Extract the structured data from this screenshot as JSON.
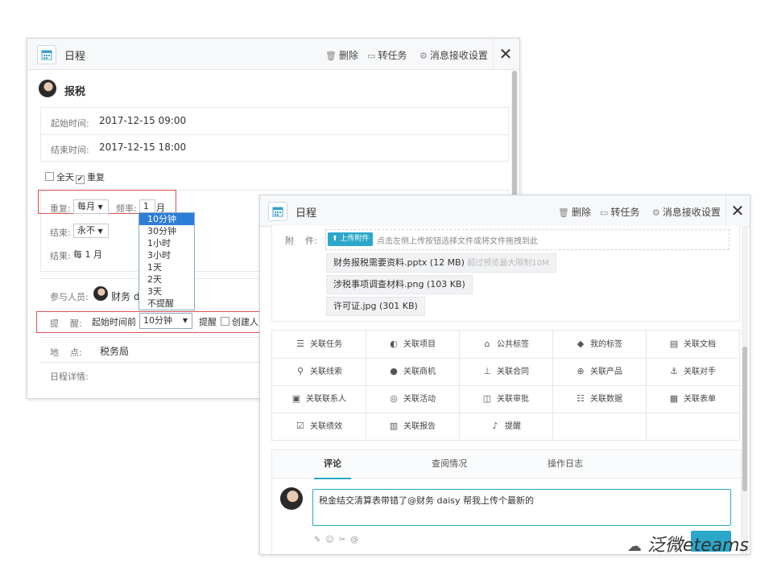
{
  "window1": {
    "title": "日程",
    "actions": {
      "delete": "删除",
      "convert_task": "转任务",
      "message_settings": "消息接收设置"
    },
    "subject": "报税",
    "start_label": "起始时间:",
    "start_value": "2017-12-15 09:00",
    "end_label": "结束时间:",
    "end_value": "2017-12-15 18:00",
    "all_day": "全天",
    "repeat": "重复",
    "repeat_label": "重复:",
    "repeat_value": "每月",
    "frequency_label": "频率:",
    "frequency_value": "1",
    "frequency_unit": "月",
    "end_repeat_label": "结束:",
    "end_repeat_value": "永不",
    "result_label": "结果:",
    "result_value": "每 1 月",
    "participants_label": "参与人员:",
    "participant_name": "财务 de",
    "reminder_label": "提    醒:",
    "reminder_prefix": "起始时间前",
    "reminder_value": "10分钟",
    "reminder_option": "提醒",
    "reminder_creator": "创建人",
    "location_label": "地    点:",
    "location_value": "税务局",
    "details_label": "日程详情:",
    "dropdown_options": [
      "10分钟",
      "30分钟",
      "1小时",
      "3小时",
      "1天",
      "2天",
      "3天",
      "不提醒"
    ],
    "dropdown_selected": "10分钟"
  },
  "window2": {
    "title": "日程",
    "actions": {
      "delete": "删除",
      "convert_task": "转任务",
      "message_settings": "消息接收设置"
    },
    "attachment_label": "附    件:",
    "upload_button": "上传附件",
    "upload_hint": "点击左侧上传按钮选择文件或将文件拖拽到此",
    "files": [
      {
        "name": "财务报税需要资料.pptx (12 MB)",
        "note": "超过预览最大限制10M"
      },
      {
        "name": "涉税事项调查材料.png (103 KB)",
        "note": ""
      },
      {
        "name": "许可证.jpg (301 KB)",
        "note": ""
      }
    ],
    "relations": [
      {
        "icon": "list-icon",
        "label": "关联任务"
      },
      {
        "icon": "half-circle-icon",
        "label": "关联项目"
      },
      {
        "icon": "tag-icon",
        "label": "公共标签"
      },
      {
        "icon": "tag-icon",
        "label": "我的标签"
      },
      {
        "icon": "document-icon",
        "label": "关联文档"
      },
      {
        "icon": "clue-icon",
        "label": "关联线索"
      },
      {
        "icon": "opportunity-icon",
        "label": "关联商机"
      },
      {
        "icon": "contract-icon",
        "label": "关联合同"
      },
      {
        "icon": "globe-icon",
        "label": "关联产品"
      },
      {
        "icon": "competitor-icon",
        "label": "关联对手"
      },
      {
        "icon": "contact-icon",
        "label": "关联联系人"
      },
      {
        "icon": "activity-icon",
        "label": "关联活动"
      },
      {
        "icon": "approval-icon",
        "label": "关联审批"
      },
      {
        "icon": "data-icon",
        "label": "关联数据"
      },
      {
        "icon": "table-icon",
        "label": "关联表单"
      },
      {
        "icon": "performance-icon",
        "label": "关联绩效"
      },
      {
        "icon": "report-icon",
        "label": "关联报告"
      },
      {
        "icon": "bell-icon",
        "label": "提醒"
      }
    ],
    "tabs": [
      "评论",
      "查阅情况",
      "操作日志"
    ],
    "active_tab": "评论",
    "comment_text": "税金结交清算表带错了@财务 daisy 帮我上传个最新的"
  },
  "watermark": "泛微eteams",
  "colors": {
    "accent": "#2aa7c9",
    "selected": "#2c7dd6",
    "highlight_border": "#d9534f"
  }
}
